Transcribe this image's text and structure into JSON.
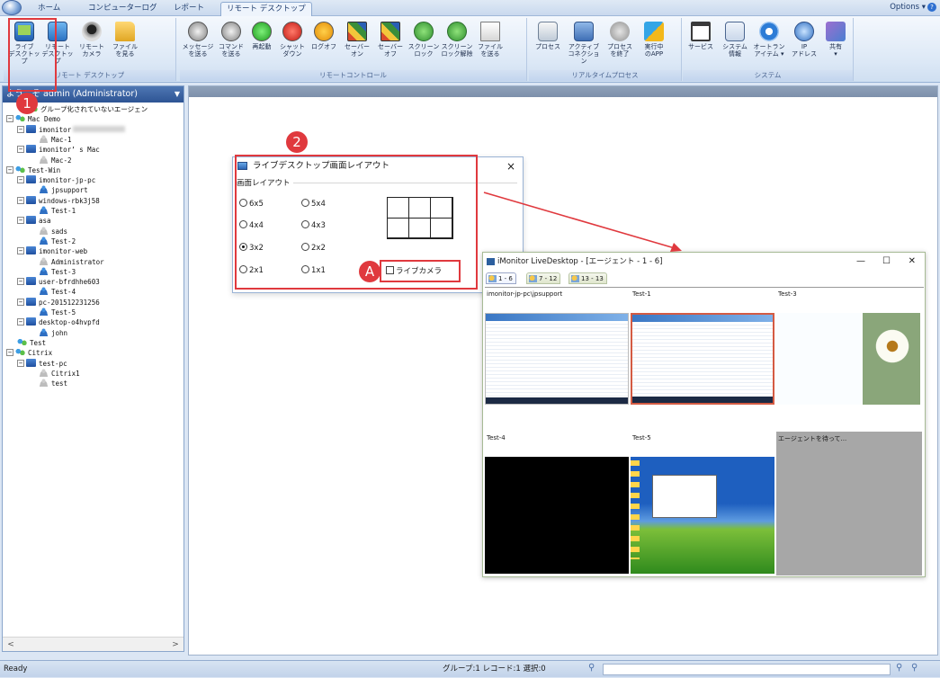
{
  "tabs": [
    "ホーム",
    "コンピューターログ",
    "レポート",
    "リモート デスクトップ"
  ],
  "options_label": "Options",
  "help_glyph": "?",
  "ribbon": {
    "groups": [
      {
        "label": "リモート デスクトップ",
        "buttons": [
          {
            "label": "ライブ\nデスクトップ",
            "icon": "live-desktop-icon"
          },
          {
            "label": "リモート\nデスクトップ",
            "icon": "remote-desktop-icon"
          },
          {
            "label": "リモート\nカメラ",
            "icon": "remote-camera-icon"
          },
          {
            "label": "ファイル\nを見る",
            "icon": "file-view-icon"
          }
        ]
      },
      {
        "label": "リモートコントロール",
        "buttons": [
          {
            "label": "メッセージ\nを送る",
            "icon": "message-icon"
          },
          {
            "label": "コマンド\nを送る",
            "icon": "command-icon"
          },
          {
            "label": "再起動",
            "icon": "restart-icon"
          },
          {
            "label": "シャット\nダウン",
            "icon": "shutdown-icon"
          },
          {
            "label": "ログオフ",
            "icon": "logoff-icon"
          },
          {
            "label": "セーバー\nオン",
            "icon": "saver-on-icon"
          },
          {
            "label": "セーバー\nオフ",
            "icon": "saver-off-icon"
          },
          {
            "label": "スクリーン\nロック",
            "icon": "screen-lock-icon"
          },
          {
            "label": "スクリーン\nロック解除",
            "icon": "screen-unlock-icon"
          },
          {
            "label": "ファイル\nを送る",
            "icon": "send-file-icon"
          }
        ]
      },
      {
        "label": "リアルタイムプロセス",
        "buttons": [
          {
            "label": "プロセス",
            "icon": "process-icon"
          },
          {
            "label": "アクティブ\nコネクション",
            "icon": "connection-icon"
          },
          {
            "label": "プロセス\nを終了",
            "icon": "kill-process-icon"
          },
          {
            "label": "実行中\nのAPP",
            "icon": "running-app-icon"
          }
        ]
      },
      {
        "label": "システム",
        "buttons": [
          {
            "label": "サービス",
            "icon": "service-icon"
          },
          {
            "label": "システム\n情報",
            "icon": "system-info-icon"
          },
          {
            "label": "オートラン\nアイテム ▾",
            "icon": "autorun-icon"
          },
          {
            "label": "IP\nアドレス",
            "icon": "ip-address-icon"
          },
          {
            "label": "共有\n▾",
            "icon": "share-icon"
          }
        ]
      }
    ]
  },
  "markers": {
    "one": "1",
    "two": "2",
    "a": "A"
  },
  "panel": {
    "header": "ようこそ admin (Administrator)",
    "dropdown": "▼"
  },
  "tree": [
    {
      "label": "グループ化されていないエージェン",
      "icon": "group",
      "level": 1,
      "toggle": ""
    },
    {
      "label": "Mac Demo",
      "icon": "group",
      "level": 0,
      "toggle": "−"
    },
    {
      "label": "imonitor",
      "icon": "pc",
      "level": 1,
      "toggle": "−",
      "blur": true
    },
    {
      "label": "Mac-1",
      "icon": "user",
      "level": 2,
      "toggle": ""
    },
    {
      "label": "imonitor’ s Mac",
      "icon": "pc",
      "level": 1,
      "toggle": "−"
    },
    {
      "label": "Mac-2",
      "icon": "user",
      "level": 2,
      "toggle": ""
    },
    {
      "label": "Test-Win",
      "icon": "group",
      "level": 0,
      "toggle": "−"
    },
    {
      "label": "imonitor-jp-pc",
      "icon": "pc",
      "level": 1,
      "toggle": "−"
    },
    {
      "label": "jpsupport",
      "icon": "user-blue",
      "level": 2,
      "toggle": ""
    },
    {
      "label": "windows-rbk3j58",
      "icon": "pc",
      "level": 1,
      "toggle": "−"
    },
    {
      "label": "Test-1",
      "icon": "user-blue",
      "level": 2,
      "toggle": ""
    },
    {
      "label": "asa",
      "icon": "pc",
      "level": 1,
      "toggle": "−"
    },
    {
      "label": "sads",
      "icon": "user",
      "level": 2,
      "toggle": ""
    },
    {
      "label": "Test-2",
      "icon": "user-blue",
      "level": 2,
      "toggle": ""
    },
    {
      "label": "imonitor-web",
      "icon": "pc",
      "level": 1,
      "toggle": "−"
    },
    {
      "label": "Administrator",
      "icon": "user",
      "level": 2,
      "toggle": ""
    },
    {
      "label": "Test-3",
      "icon": "user-blue",
      "level": 2,
      "toggle": ""
    },
    {
      "label": "user-bfrdhhe603",
      "icon": "pc",
      "level": 1,
      "toggle": "−"
    },
    {
      "label": "Test-4",
      "icon": "user-blue",
      "level": 2,
      "toggle": ""
    },
    {
      "label": "pc-201512231256",
      "icon": "pc",
      "level": 1,
      "toggle": "−"
    },
    {
      "label": "Test-5",
      "icon": "user-blue",
      "level": 2,
      "toggle": ""
    },
    {
      "label": "desktop-o4hvpfd",
      "icon": "pc",
      "level": 1,
      "toggle": "−"
    },
    {
      "label": "john",
      "icon": "user-blue",
      "level": 2,
      "toggle": ""
    },
    {
      "label": "Test",
      "icon": "group",
      "level": 0,
      "toggle": ""
    },
    {
      "label": "Citrix",
      "icon": "group",
      "level": 0,
      "toggle": "−"
    },
    {
      "label": "test-pc",
      "icon": "pc",
      "level": 1,
      "toggle": "−"
    },
    {
      "label": "Citrix1",
      "icon": "user",
      "level": 2,
      "toggle": ""
    },
    {
      "label": "test",
      "icon": "user",
      "level": 2,
      "toggle": ""
    }
  ],
  "scroll": {
    "left": "<",
    "right": ">"
  },
  "dialog": {
    "title": "ライブデスクトップ画面レイアウト",
    "close": "×",
    "group_label": "画面レイアウト",
    "options": [
      "6x5",
      "5x4",
      "4x4",
      "4x3",
      "3x2",
      "2x2",
      "2x1",
      "1x1"
    ],
    "selected": "3x2",
    "live_camera_label": "ライブカメラ"
  },
  "live_window": {
    "title": "iMonitor LiveDesktop - [エージェント - 1 - 6]",
    "controls": {
      "minimize": "—",
      "maximize": "☐",
      "close": "✕"
    },
    "tabs": [
      "1 - 6",
      "7 - 12",
      "13 - 13"
    ],
    "cells": [
      {
        "label": "imonitor-jp-pc\\jpsupport"
      },
      {
        "label": "Test-1"
      },
      {
        "label": "Test-3"
      },
      {
        "label": "Test-4"
      },
      {
        "label": "Test-5"
      },
      {
        "label": "エージェントを待って..."
      }
    ]
  },
  "status": {
    "ready": "Ready",
    "counts": "グループ:1 レコード:1 選択:0"
  },
  "colors": {
    "highlight": "#e0393e",
    "accent": "#2d5494"
  }
}
